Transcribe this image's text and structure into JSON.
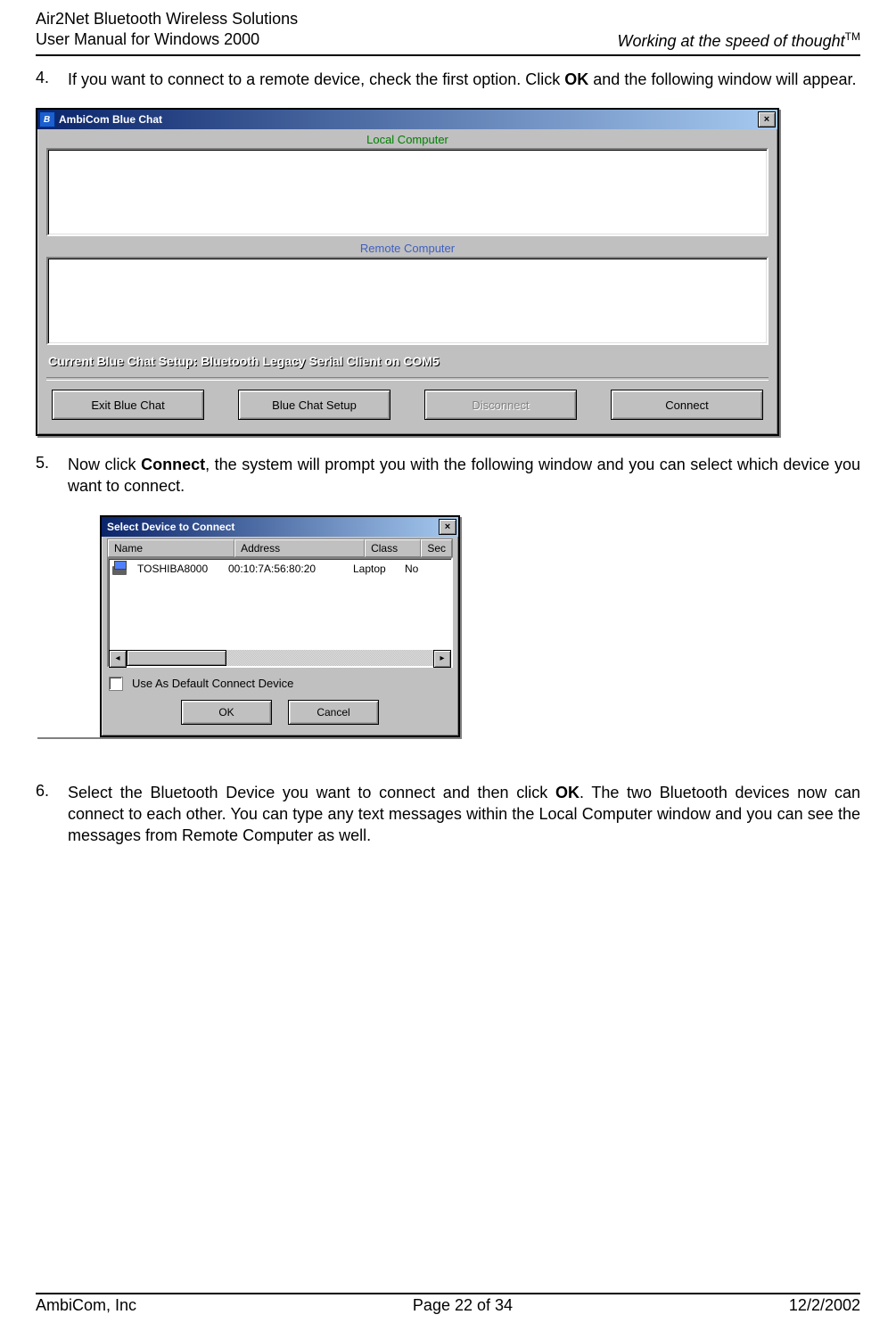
{
  "header": {
    "title_line1": "Air2Net Bluetooth Wireless Solutions",
    "title_line2": "User Manual for Windows 2000",
    "tagline": "Working at the speed of thought",
    "tm": "TM"
  },
  "steps": {
    "s4": {
      "num": "4.",
      "pre": "If you want to connect to a remote device, check the first option. Click ",
      "bold": "OK",
      "post": " and the following window will appear."
    },
    "s5": {
      "num": "5.",
      "pre": "Now click ",
      "bold": "Connect",
      "post": ", the system will prompt you with the following window and you can select which device you want to connect."
    },
    "s6": {
      "num": "6.",
      "pre": "Select the Bluetooth Device you want to connect and then click ",
      "bold": "OK",
      "post": ". The two Bluetooth devices now can connect to each other. You can type any text messages within the Local Computer window and you can see the messages from Remote Computer as well."
    }
  },
  "window1": {
    "title": "AmbiCom Blue Chat",
    "close": "×",
    "local_label": "Local Computer",
    "remote_label": "Remote Computer",
    "setup_text": "Current Blue Chat Setup: Bluetooth Legacy Serial Client on COM5",
    "buttons": {
      "exit": "Exit Blue Chat",
      "setup": "Blue Chat Setup",
      "disconnect": "Disconnect",
      "connect": "Connect"
    }
  },
  "window2": {
    "title": "Select Device to Connect",
    "close": "×",
    "headers": {
      "name": "Name",
      "address": "Address",
      "class": "Class",
      "sec": "Sec"
    },
    "row": {
      "name": "TOSHIBA8000",
      "address": "00:10:7A:56:80:20",
      "class": "Laptop",
      "sec": "No"
    },
    "scroll_left": "◂",
    "scroll_right": "▸",
    "checkbox_label": "Use As Default Connect Device",
    "ok": "OK",
    "cancel": "Cancel"
  },
  "footer": {
    "company": "AmbiCom, Inc",
    "page": "Page 22 of 34",
    "date": "12/2/2002"
  }
}
